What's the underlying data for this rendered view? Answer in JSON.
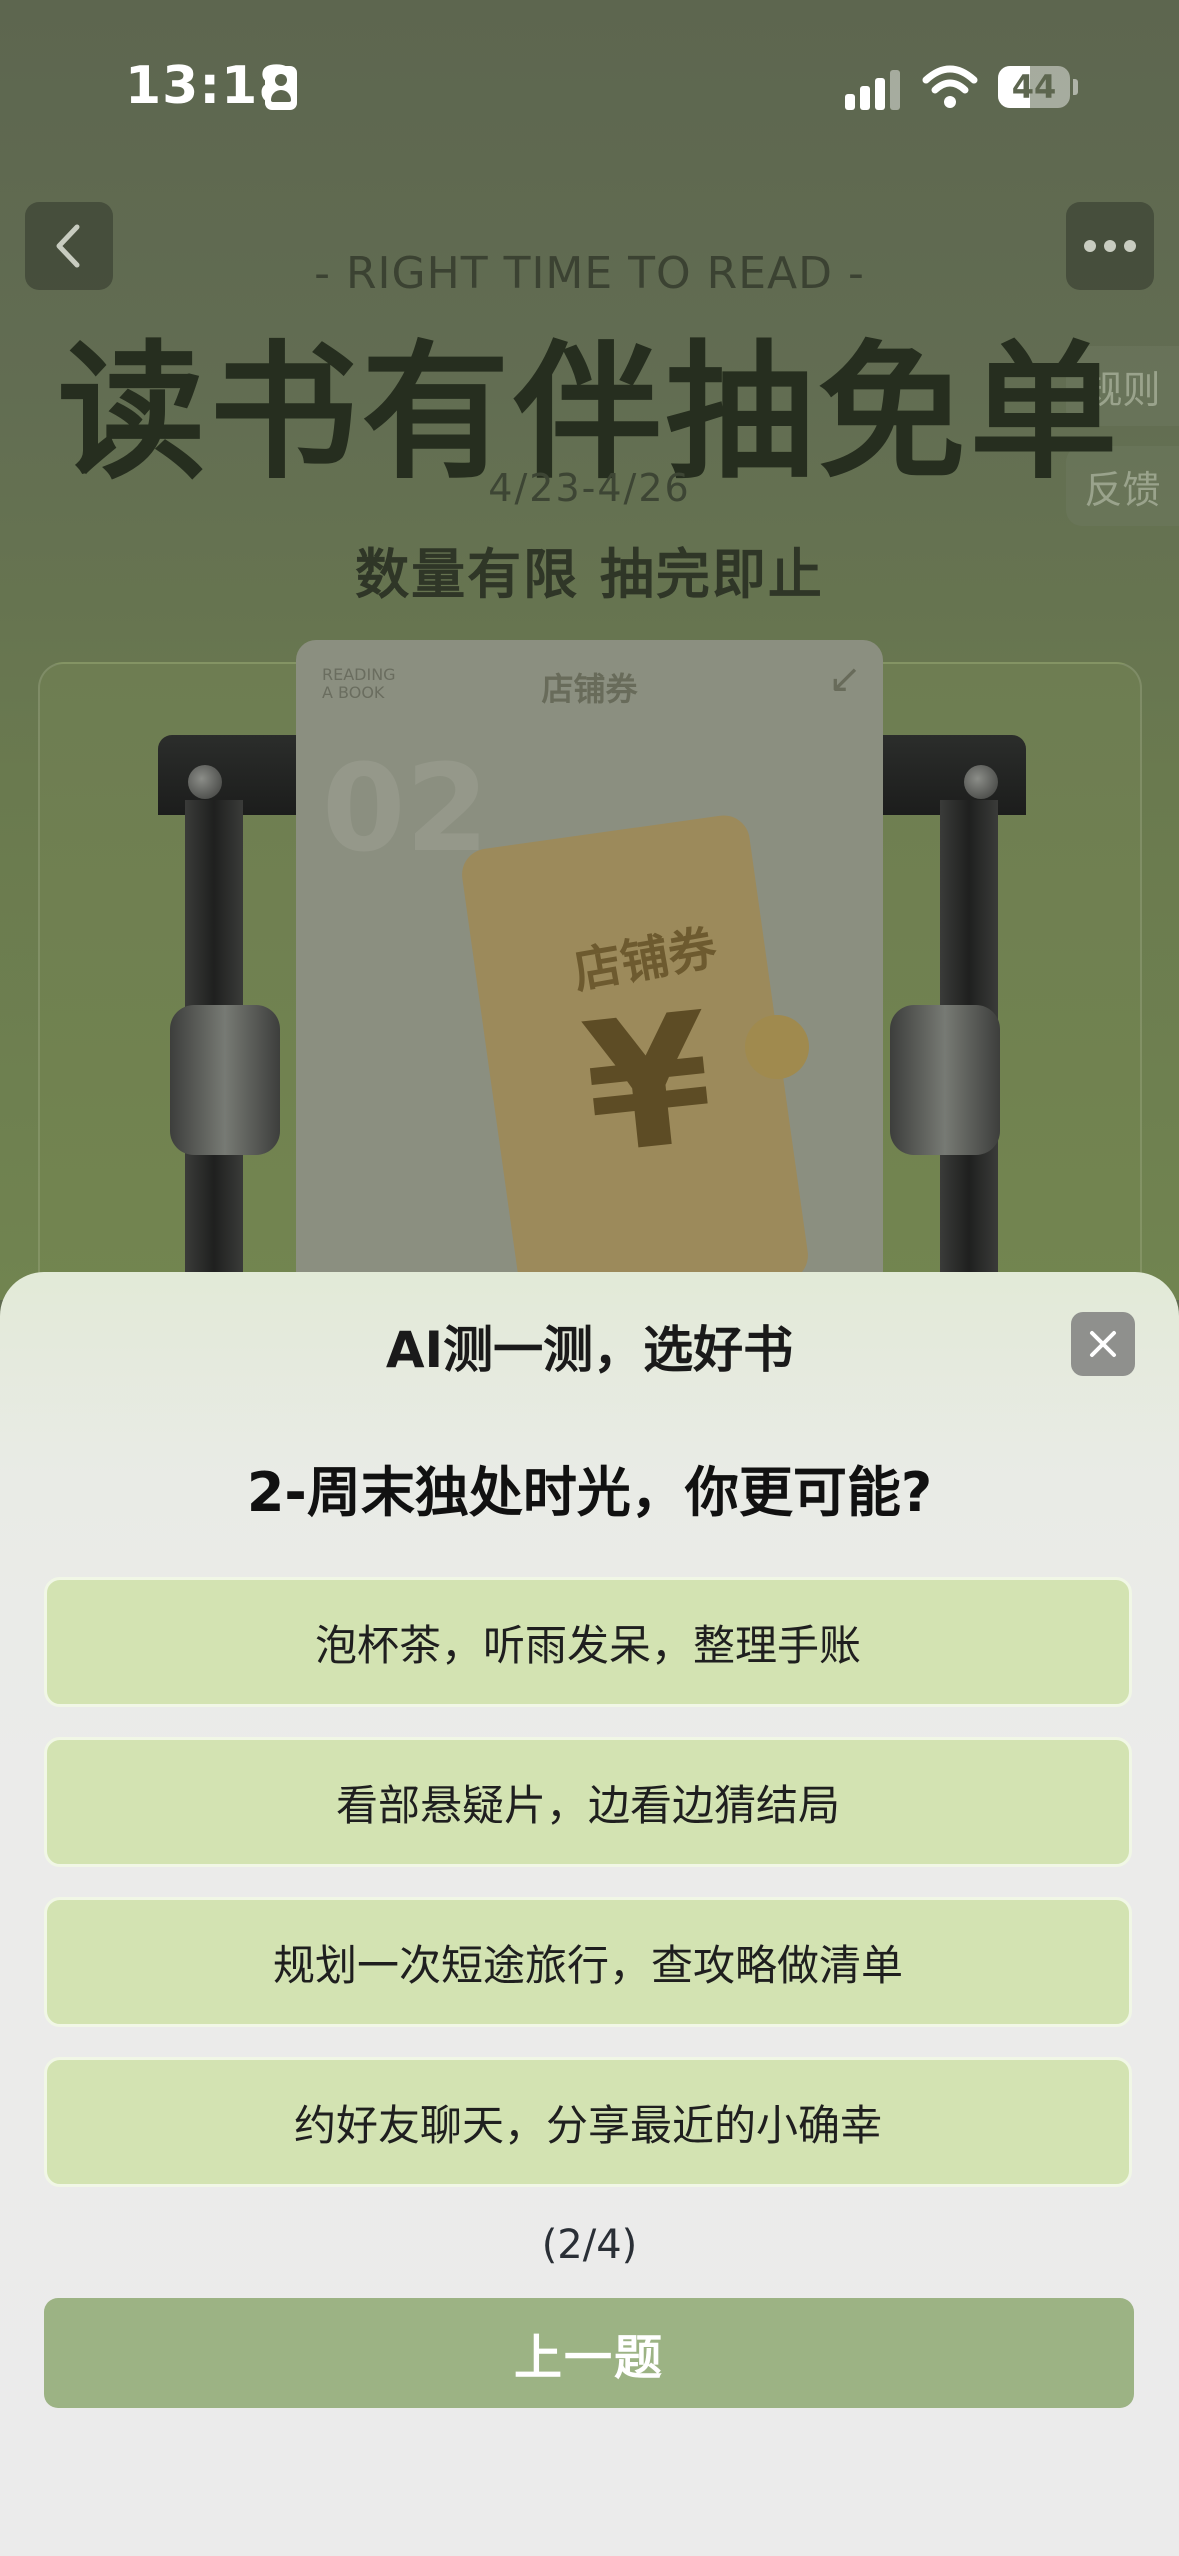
{
  "status_bar": {
    "time": "13:18",
    "battery": "44",
    "battery_level_percent": 44,
    "icons": [
      "contact-card-icon",
      "signal-icon",
      "wifi-icon",
      "battery-icon"
    ]
  },
  "nav": {
    "back_icon": "chevron-left-icon",
    "more_icon": "more-dots-icon"
  },
  "side_tabs": {
    "rules": "规则",
    "feedback": "反馈"
  },
  "banner": {
    "subtitle": "- RIGHT TIME TO READ -",
    "title": "读书有伴抽免单",
    "date": "4/23-4/26",
    "tagline": "数量有限 抽完即止"
  },
  "coupon": {
    "corner_text": "READING\nA BOOK",
    "header": "店铺券",
    "number": "02",
    "ticket_label": "店铺券",
    "ticket_symbol": "¥"
  },
  "sheet": {
    "title": "AI测一测，选好书",
    "question": "2-周末独处时光，你更可能?",
    "options": [
      "泡杯茶，听雨发呆，整理手账",
      "看部悬疑片，边看边猜结局",
      "规划一次短途旅行，查攻略做清单",
      "约好友聊天，分享最近的小确幸"
    ],
    "progress": "(2/4)",
    "prev_label": "上一题",
    "close_icon": "close-icon"
  },
  "colors": {
    "option_bg": "#d3e3b2",
    "prev_button_bg": "#9cb384",
    "banner_bg": "#5f6a50"
  }
}
